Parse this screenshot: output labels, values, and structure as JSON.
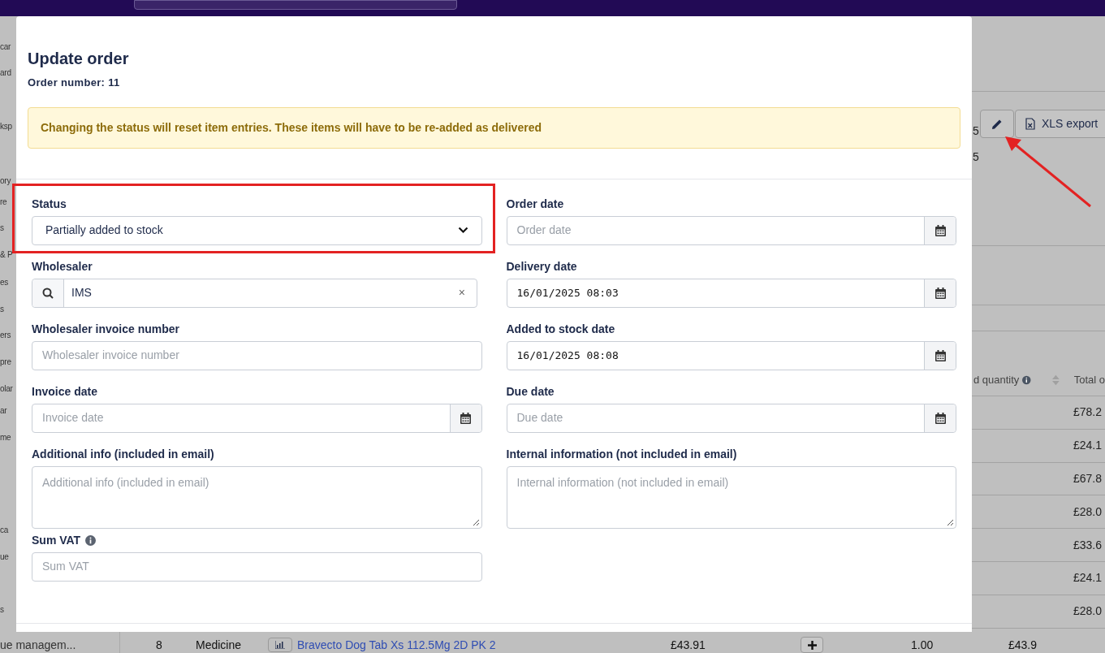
{
  "background": {
    "sidebar_items": [
      "car",
      "ard",
      "ksp",
      "ory",
      "re",
      "s",
      "& P",
      "es",
      "s",
      "ers",
      "pre",
      "olar",
      "ar",
      "me",
      "ca",
      "ue",
      "s"
    ],
    "sidebar_footer": "ue managem...",
    "summary_values": [
      "5",
      "5"
    ],
    "export_button": "XLS export",
    "table": {
      "columns": [
        "d quantity",
        "Total o"
      ],
      "totals": [
        "£78.2",
        "£24.1",
        "£67.8",
        "£28.0",
        "£33.6",
        "£24.1",
        "£28.0"
      ],
      "last_row": {
        "number": "8",
        "type": "Medicine",
        "product": "Bravecto Dog Tab Xs 112.5Mg 2D PK 2",
        "price": "£43.91",
        "quantity": "1.00",
        "total": "£43.9"
      }
    }
  },
  "modal": {
    "title": "Update order",
    "order_number": "Order number: 11",
    "alert": "Changing the status will reset item entries. These items will have to be re-added as delivered",
    "left_fields": [
      {
        "label": "Status",
        "kind": "select",
        "value": "Partially added to stock",
        "highlighted": true
      },
      {
        "label": "Wholesaler",
        "kind": "search",
        "value": "IMS",
        "clear": "×",
        "highlighted": false
      },
      {
        "label": "Wholesaler invoice number",
        "kind": "text",
        "placeholder": "Wholesaler invoice number",
        "highlighted": false
      },
      {
        "label": "Invoice date",
        "kind": "date",
        "placeholder": "Invoice date",
        "highlighted": false
      },
      {
        "label": "Additional info (included in email)",
        "kind": "textarea",
        "placeholder": "Additional info (included in email)",
        "highlighted": false
      },
      {
        "label": "Sum VAT",
        "kind": "text",
        "placeholder": "Sum VAT",
        "info": true,
        "highlighted": false
      }
    ],
    "right_fields": [
      {
        "label": "Order date",
        "kind": "date",
        "placeholder": "Order date",
        "highlighted": false
      },
      {
        "label": "Delivery date",
        "kind": "date",
        "value": "16/01/2025 08:03",
        "highlighted": false
      },
      {
        "label": "Added to stock date",
        "kind": "date",
        "value": "16/01/2025 08:08",
        "highlighted": false
      },
      {
        "label": "Due date",
        "kind": "date",
        "placeholder": "Due date",
        "highlighted": false
      },
      {
        "label": "Internal information (not included in email)",
        "kind": "textarea",
        "placeholder": "Internal information (not included in email)",
        "highlighted": false
      }
    ]
  }
}
